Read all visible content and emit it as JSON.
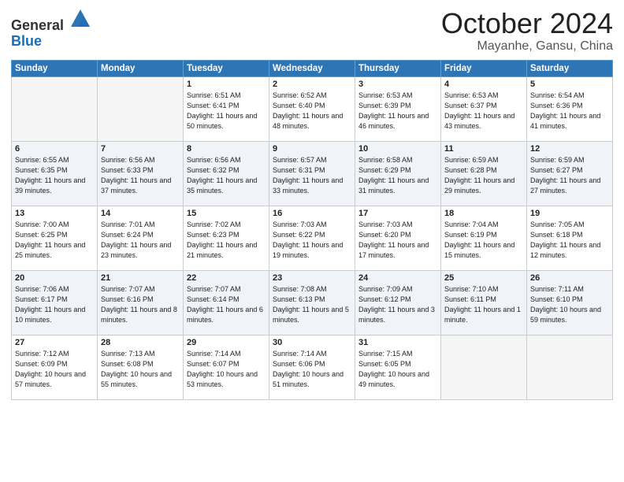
{
  "header": {
    "logo_line1": "General",
    "logo_line2": "Blue",
    "month": "October 2024",
    "location": "Mayanhe, Gansu, China"
  },
  "weekdays": [
    "Sunday",
    "Monday",
    "Tuesday",
    "Wednesday",
    "Thursday",
    "Friday",
    "Saturday"
  ],
  "weeks": [
    [
      {
        "day": "",
        "sunrise": "",
        "sunset": "",
        "daylight": ""
      },
      {
        "day": "",
        "sunrise": "",
        "sunset": "",
        "daylight": ""
      },
      {
        "day": "1",
        "sunrise": "Sunrise: 6:51 AM",
        "sunset": "Sunset: 6:41 PM",
        "daylight": "Daylight: 11 hours and 50 minutes."
      },
      {
        "day": "2",
        "sunrise": "Sunrise: 6:52 AM",
        "sunset": "Sunset: 6:40 PM",
        "daylight": "Daylight: 11 hours and 48 minutes."
      },
      {
        "day": "3",
        "sunrise": "Sunrise: 6:53 AM",
        "sunset": "Sunset: 6:39 PM",
        "daylight": "Daylight: 11 hours and 46 minutes."
      },
      {
        "day": "4",
        "sunrise": "Sunrise: 6:53 AM",
        "sunset": "Sunset: 6:37 PM",
        "daylight": "Daylight: 11 hours and 43 minutes."
      },
      {
        "day": "5",
        "sunrise": "Sunrise: 6:54 AM",
        "sunset": "Sunset: 6:36 PM",
        "daylight": "Daylight: 11 hours and 41 minutes."
      }
    ],
    [
      {
        "day": "6",
        "sunrise": "Sunrise: 6:55 AM",
        "sunset": "Sunset: 6:35 PM",
        "daylight": "Daylight: 11 hours and 39 minutes."
      },
      {
        "day": "7",
        "sunrise": "Sunrise: 6:56 AM",
        "sunset": "Sunset: 6:33 PM",
        "daylight": "Daylight: 11 hours and 37 minutes."
      },
      {
        "day": "8",
        "sunrise": "Sunrise: 6:56 AM",
        "sunset": "Sunset: 6:32 PM",
        "daylight": "Daylight: 11 hours and 35 minutes."
      },
      {
        "day": "9",
        "sunrise": "Sunrise: 6:57 AM",
        "sunset": "Sunset: 6:31 PM",
        "daylight": "Daylight: 11 hours and 33 minutes."
      },
      {
        "day": "10",
        "sunrise": "Sunrise: 6:58 AM",
        "sunset": "Sunset: 6:29 PM",
        "daylight": "Daylight: 11 hours and 31 minutes."
      },
      {
        "day": "11",
        "sunrise": "Sunrise: 6:59 AM",
        "sunset": "Sunset: 6:28 PM",
        "daylight": "Daylight: 11 hours and 29 minutes."
      },
      {
        "day": "12",
        "sunrise": "Sunrise: 6:59 AM",
        "sunset": "Sunset: 6:27 PM",
        "daylight": "Daylight: 11 hours and 27 minutes."
      }
    ],
    [
      {
        "day": "13",
        "sunrise": "Sunrise: 7:00 AM",
        "sunset": "Sunset: 6:25 PM",
        "daylight": "Daylight: 11 hours and 25 minutes."
      },
      {
        "day": "14",
        "sunrise": "Sunrise: 7:01 AM",
        "sunset": "Sunset: 6:24 PM",
        "daylight": "Daylight: 11 hours and 23 minutes."
      },
      {
        "day": "15",
        "sunrise": "Sunrise: 7:02 AM",
        "sunset": "Sunset: 6:23 PM",
        "daylight": "Daylight: 11 hours and 21 minutes."
      },
      {
        "day": "16",
        "sunrise": "Sunrise: 7:03 AM",
        "sunset": "Sunset: 6:22 PM",
        "daylight": "Daylight: 11 hours and 19 minutes."
      },
      {
        "day": "17",
        "sunrise": "Sunrise: 7:03 AM",
        "sunset": "Sunset: 6:20 PM",
        "daylight": "Daylight: 11 hours and 17 minutes."
      },
      {
        "day": "18",
        "sunrise": "Sunrise: 7:04 AM",
        "sunset": "Sunset: 6:19 PM",
        "daylight": "Daylight: 11 hours and 15 minutes."
      },
      {
        "day": "19",
        "sunrise": "Sunrise: 7:05 AM",
        "sunset": "Sunset: 6:18 PM",
        "daylight": "Daylight: 11 hours and 12 minutes."
      }
    ],
    [
      {
        "day": "20",
        "sunrise": "Sunrise: 7:06 AM",
        "sunset": "Sunset: 6:17 PM",
        "daylight": "Daylight: 11 hours and 10 minutes."
      },
      {
        "day": "21",
        "sunrise": "Sunrise: 7:07 AM",
        "sunset": "Sunset: 6:16 PM",
        "daylight": "Daylight: 11 hours and 8 minutes."
      },
      {
        "day": "22",
        "sunrise": "Sunrise: 7:07 AM",
        "sunset": "Sunset: 6:14 PM",
        "daylight": "Daylight: 11 hours and 6 minutes."
      },
      {
        "day": "23",
        "sunrise": "Sunrise: 7:08 AM",
        "sunset": "Sunset: 6:13 PM",
        "daylight": "Daylight: 11 hours and 5 minutes."
      },
      {
        "day": "24",
        "sunrise": "Sunrise: 7:09 AM",
        "sunset": "Sunset: 6:12 PM",
        "daylight": "Daylight: 11 hours and 3 minutes."
      },
      {
        "day": "25",
        "sunrise": "Sunrise: 7:10 AM",
        "sunset": "Sunset: 6:11 PM",
        "daylight": "Daylight: 11 hours and 1 minute."
      },
      {
        "day": "26",
        "sunrise": "Sunrise: 7:11 AM",
        "sunset": "Sunset: 6:10 PM",
        "daylight": "Daylight: 10 hours and 59 minutes."
      }
    ],
    [
      {
        "day": "27",
        "sunrise": "Sunrise: 7:12 AM",
        "sunset": "Sunset: 6:09 PM",
        "daylight": "Daylight: 10 hours and 57 minutes."
      },
      {
        "day": "28",
        "sunrise": "Sunrise: 7:13 AM",
        "sunset": "Sunset: 6:08 PM",
        "daylight": "Daylight: 10 hours and 55 minutes."
      },
      {
        "day": "29",
        "sunrise": "Sunrise: 7:14 AM",
        "sunset": "Sunset: 6:07 PM",
        "daylight": "Daylight: 10 hours and 53 minutes."
      },
      {
        "day": "30",
        "sunrise": "Sunrise: 7:14 AM",
        "sunset": "Sunset: 6:06 PM",
        "daylight": "Daylight: 10 hours and 51 minutes."
      },
      {
        "day": "31",
        "sunrise": "Sunrise: 7:15 AM",
        "sunset": "Sunset: 6:05 PM",
        "daylight": "Daylight: 10 hours and 49 minutes."
      },
      {
        "day": "",
        "sunrise": "",
        "sunset": "",
        "daylight": ""
      },
      {
        "day": "",
        "sunrise": "",
        "sunset": "",
        "daylight": ""
      }
    ]
  ]
}
